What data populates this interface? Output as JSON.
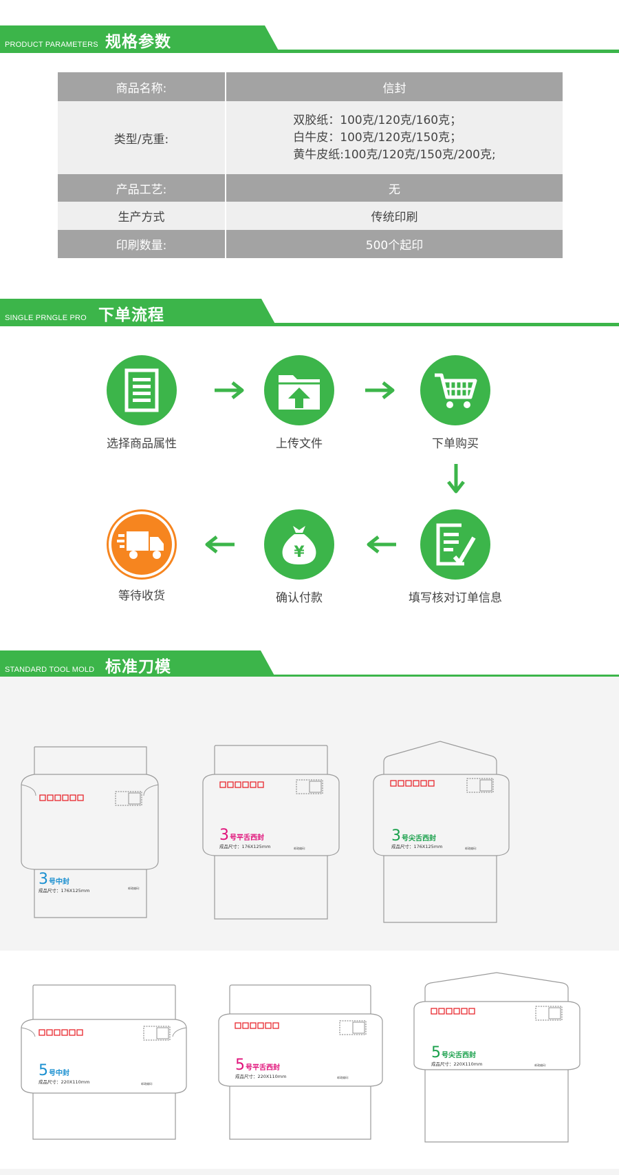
{
  "sections": {
    "params": {
      "en": "PRODUCT PARAMETERS",
      "cn": "规格参数"
    },
    "process": {
      "en": "SINGLE PRNGLE PRO",
      "cn": "下单流程"
    },
    "mold": {
      "en": "STANDARD TOOL MOLD",
      "cn": "标准刀模"
    }
  },
  "params_table": {
    "rows": [
      {
        "key": "商品名称:",
        "value": "信封"
      },
      {
        "key": "类型/克重:",
        "lines": [
          "双胶纸：100克/120克/160克；",
          "白牛皮：100克/120克/150克；",
          "黄牛皮纸:100克/120克/150克/200克;"
        ]
      },
      {
        "key": "产品工艺:",
        "value": "无"
      },
      {
        "key": "生产方式",
        "value": "传统印刷"
      },
      {
        "key": "印刷数量:",
        "value": "500个起印"
      }
    ]
  },
  "process_steps": [
    {
      "label": "选择商品属性",
      "icon": "document-icon"
    },
    {
      "label": "上传文件",
      "icon": "upload-folder-icon"
    },
    {
      "label": "下单购买",
      "icon": "cart-icon"
    },
    {
      "label": "填写核对订单信息",
      "icon": "edit-form-icon"
    },
    {
      "label": "确认付款",
      "icon": "money-bag-icon"
    },
    {
      "label": "等待收货",
      "icon": "truck-icon"
    }
  ],
  "envelopes": [
    {
      "num": "3",
      "name": "号中封",
      "size": "成品尺寸：176X125mm",
      "color": "#1a8fd0"
    },
    {
      "num": "3",
      "name": "号平舌西封",
      "size": "成品尺寸：176X125mm",
      "color": "#e0127a"
    },
    {
      "num": "3",
      "name": "号尖舌西封",
      "size": "成品尺寸：176X125mm",
      "color": "#19a04b"
    },
    {
      "num": "5",
      "name": "号中封",
      "size": "成品尺寸：220X110mm",
      "color": "#1a8fd0"
    },
    {
      "num": "5",
      "name": "号平舌西封",
      "size": "成品尺寸：220X110mm",
      "color": "#e0127a"
    },
    {
      "num": "5",
      "name": "号尖舌西封",
      "size": "成品尺寸：220X110mm",
      "color": "#19a04b"
    }
  ],
  "colors": {
    "green": "#3cb54a",
    "orange": "#f6851f",
    "table_dark": "#a3a3a3",
    "table_light": "#efefef",
    "postcode_red": "#e8262d"
  }
}
